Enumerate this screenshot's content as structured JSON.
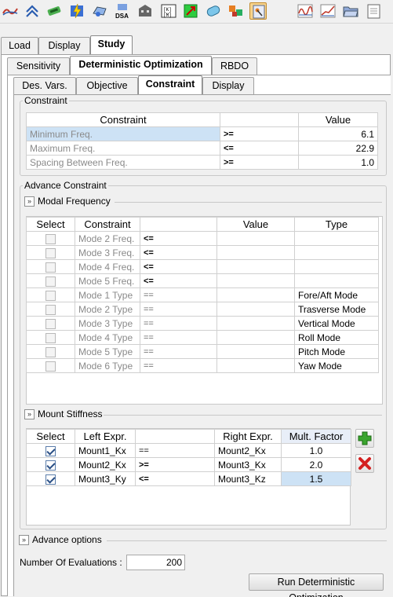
{
  "toolbar": {
    "icons": [
      "curve-icon",
      "chevrons-icon",
      "hammer-icon",
      "lightning-icon",
      "part-icon",
      "dsa-icon",
      "building-icon",
      "matrix-icon",
      "resize-icon",
      "cylinder-icon",
      "cubes-icon",
      "pin-icon",
      "wave-chart-icon",
      "line-chart-icon",
      "folder-icon",
      "window-icon"
    ],
    "dsa_label": "DSA"
  },
  "tabs_main": [
    "Load",
    "Display",
    "Study"
  ],
  "tabs_study": [
    "Sensitivity",
    "Deterministic Optimization",
    "RBDO"
  ],
  "tabs_det": [
    "Des. Vars.",
    "Objective",
    "Constraint",
    "Display"
  ],
  "constraint_group": {
    "title": "Constraint",
    "headers": [
      "Constraint",
      "Value"
    ],
    "rows": [
      {
        "name": "Minimum Freq.",
        "op": ">=",
        "value": "6.1"
      },
      {
        "name": "Maximum Freq.",
        "op": "<=",
        "value": "22.9"
      },
      {
        "name": "Spacing Between Freq.",
        "op": ">=",
        "value": "1.0"
      }
    ]
  },
  "advance_group": {
    "title": "Advance Constraint"
  },
  "modal": {
    "title": "Modal Frequency",
    "headers": [
      "Select",
      "Constraint",
      "Value",
      "Type"
    ],
    "rows": [
      {
        "name": "Mode 2 Freq.",
        "op": "<=",
        "type": ""
      },
      {
        "name": "Mode 3 Freq.",
        "op": "<=",
        "type": ""
      },
      {
        "name": "Mode 4 Freq.",
        "op": "<=",
        "type": ""
      },
      {
        "name": "Mode 5 Freq.",
        "op": "<=",
        "type": ""
      },
      {
        "name": "Mode 1 Type",
        "op": "==",
        "type": "Fore/Aft Mode"
      },
      {
        "name": "Mode 2 Type",
        "op": "==",
        "type": "Trasverse Mode"
      },
      {
        "name": "Mode 3 Type",
        "op": "==",
        "type": "Vertical Mode"
      },
      {
        "name": "Mode 4 Type",
        "op": "==",
        "type": "Roll Mode"
      },
      {
        "name": "Mode 5 Type",
        "op": "==",
        "type": "Pitch Mode"
      },
      {
        "name": "Mode 6 Type",
        "op": "==",
        "type": "Yaw Mode"
      }
    ]
  },
  "mount": {
    "title": "Mount Stiffness",
    "headers": [
      "Select",
      "Left Expr.",
      "Right Expr.",
      "Mult. Factor"
    ],
    "rows": [
      {
        "left": "Mount1_Kx",
        "op": "==",
        "right": "Mount2_Kx",
        "factor": "1.0"
      },
      {
        "left": "Mount2_Kx",
        "op": ">=",
        "right": "Mount3_Kx",
        "factor": "2.0"
      },
      {
        "left": "Mount3_Ky",
        "op": "<=",
        "right": "Mount3_Kz",
        "factor": "1.5"
      }
    ]
  },
  "advance_options": {
    "title": "Advance options",
    "evaluations_label": "Number Of Evaluations :",
    "evaluations_value": "200"
  },
  "run_button": "Run Deterministic Optimization",
  "colors": {
    "selected_cell": "#cde2f5",
    "add_green": "#3aa52e",
    "delete_red": "#d42020"
  }
}
